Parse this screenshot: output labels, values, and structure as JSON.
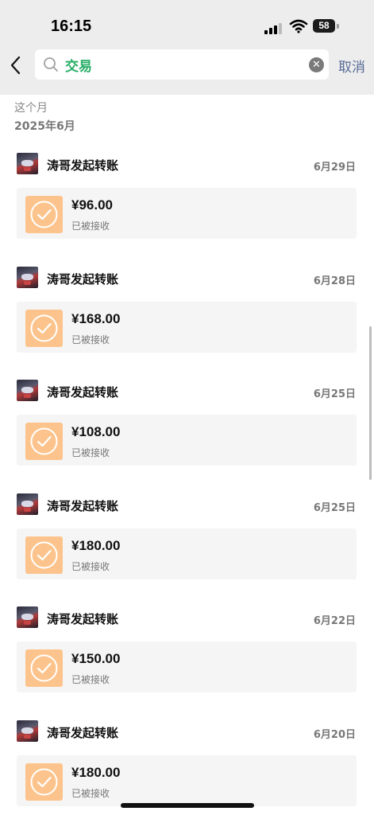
{
  "status_bar": {
    "time": "16:15",
    "battery": "58"
  },
  "search": {
    "query": "交易",
    "cancel_label": "取消"
  },
  "section": {
    "period_label": "这个月",
    "month_label": "2025年6月"
  },
  "transactions": [
    {
      "title": "涛哥发起转账",
      "date": "6月29日",
      "amount": "¥96.00",
      "status": "已被接收"
    },
    {
      "title": "涛哥发起转账",
      "date": "6月28日",
      "amount": "¥168.00",
      "status": "已被接收"
    },
    {
      "title": "涛哥发起转账",
      "date": "6月25日",
      "amount": "¥108.00",
      "status": "已被接收"
    },
    {
      "title": "涛哥发起转账",
      "date": "6月25日",
      "amount": "¥180.00",
      "status": "已被接收"
    },
    {
      "title": "涛哥发起转账",
      "date": "6月22日",
      "amount": "¥150.00",
      "status": "已被接收"
    },
    {
      "title": "涛哥发起转账",
      "date": "6月20日",
      "amount": "¥180.00",
      "status": "已被接收"
    }
  ],
  "icons": {
    "back": "chevron-left-icon",
    "search": "search-icon",
    "clear": "clear-icon",
    "check": "check-circle-icon"
  },
  "colors": {
    "header_bg": "#ededed",
    "search_text": "#2aae67",
    "cancel_link": "#576b95",
    "check_bg": "#fcc48c",
    "card_bg": "#f5f5f5"
  }
}
